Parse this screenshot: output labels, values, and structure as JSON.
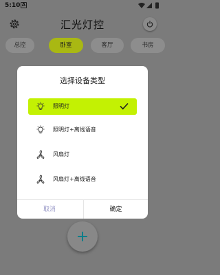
{
  "status": {
    "time": "5:10",
    "notif_letter": "A"
  },
  "app": {
    "title": "汇光灯控"
  },
  "tabs": [
    {
      "label": "总控",
      "active": false
    },
    {
      "label": "卧室",
      "active": true
    },
    {
      "label": "客厅",
      "active": false
    },
    {
      "label": "书房",
      "active": false
    }
  ],
  "dialog": {
    "title": "选择设备类型",
    "options": [
      {
        "label": "照明灯",
        "icon": "lightbulb-icon",
        "selected": true
      },
      {
        "label": "照明灯+离线语音",
        "icon": "lightbulb-icon",
        "selected": false
      },
      {
        "label": "风扇灯",
        "icon": "fan-icon",
        "selected": false
      },
      {
        "label": "风扇灯+离线语音",
        "icon": "fan-icon",
        "selected": false
      }
    ],
    "cancel_label": "取消",
    "confirm_label": "确定"
  },
  "colors": {
    "accent": "#c3f103",
    "tab_active": "#a9b813",
    "scrim": "#7b7b7b"
  }
}
